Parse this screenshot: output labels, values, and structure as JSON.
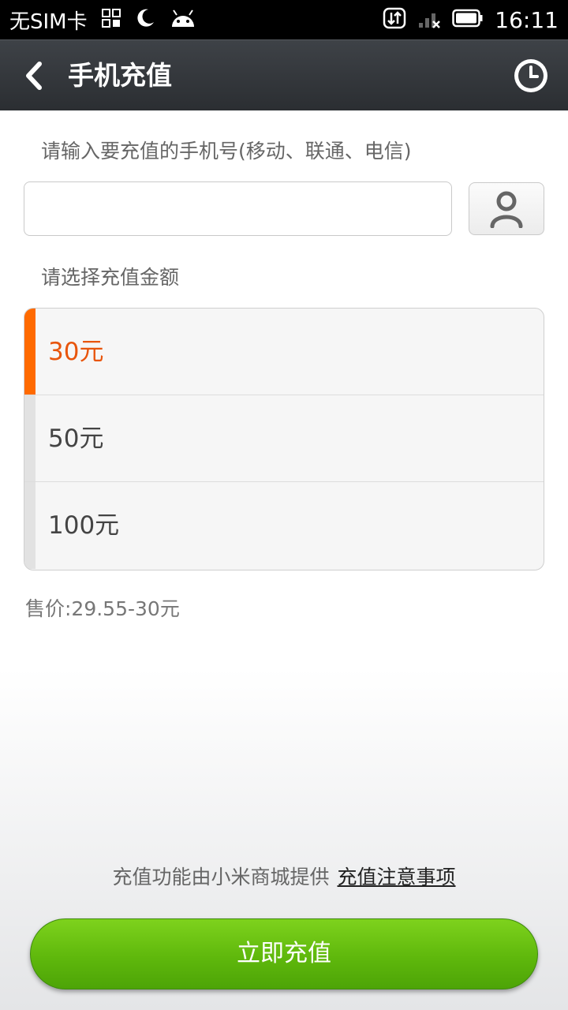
{
  "status_bar": {
    "sim_text": "无SIM卡",
    "time": "16:11",
    "icons": [
      "qr-icon",
      "moon-icon",
      "android-icon",
      "data-transfer-icon",
      "signal-icon",
      "battery-icon"
    ]
  },
  "header": {
    "title": "手机充值"
  },
  "phone_section": {
    "label": "请输入要充值的手机号(移动、联通、电信)",
    "input_value": "",
    "input_placeholder": ""
  },
  "amount_section": {
    "label": "请选择充值金额",
    "options": [
      {
        "label": "30元",
        "selected": true
      },
      {
        "label": "50元",
        "selected": false
      },
      {
        "label": "100元",
        "selected": false
      }
    ]
  },
  "price_text": "售价:29.55-30元",
  "footer": {
    "provider_text": "充值功能由小米商城提供",
    "notice_link": "充值注意事项"
  },
  "recharge_button": "立即充值",
  "colors": {
    "accent": "#ff6a00",
    "selected_text": "#e8550c",
    "button_green": "#5fb80c",
    "header_bg": "#2b2e32"
  }
}
